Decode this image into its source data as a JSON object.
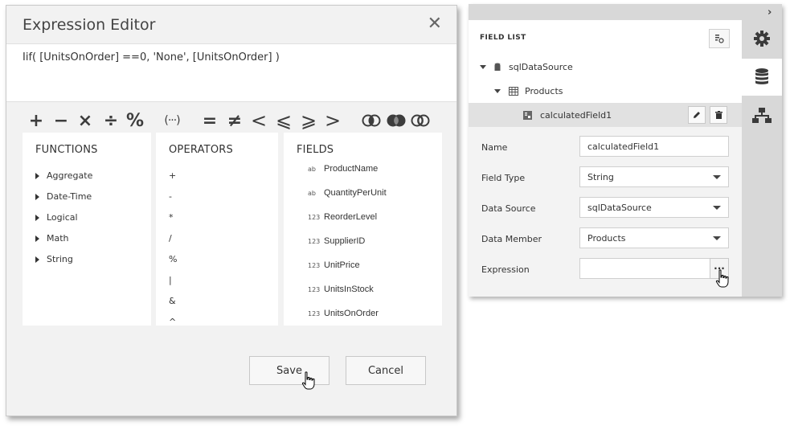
{
  "editor": {
    "title": "Expression Editor",
    "close_glyph": "✕",
    "expression": "Iif( [UnitsOnOrder] ==0, 'None', [UnitsOnOrder] )",
    "toolbar": [
      {
        "name": "plus-operator-button",
        "glyph": "+"
      },
      {
        "name": "minus-operator-button",
        "glyph": "−"
      },
      {
        "name": "multiply-operator-button",
        "glyph": "×"
      },
      {
        "name": "divide-operator-button",
        "glyph": "÷"
      },
      {
        "name": "modulo-operator-button",
        "glyph": "%"
      },
      {
        "name": "parentheses-button",
        "glyph": "(···)"
      },
      {
        "name": "equals-operator-button",
        "glyph": "="
      },
      {
        "name": "not-equal-operator-button",
        "glyph": "≠"
      },
      {
        "name": "less-than-operator-button",
        "glyph": "<"
      },
      {
        "name": "less-or-equal-operator-button",
        "glyph": "⩽"
      },
      {
        "name": "greater-or-equal-operator-button",
        "glyph": "⩾"
      },
      {
        "name": "greater-than-operator-button",
        "glyph": ">"
      },
      {
        "name": "and-operator-button",
        "glyph": "and"
      },
      {
        "name": "or-operator-button",
        "glyph": "or"
      },
      {
        "name": "not-operator-button",
        "glyph": "not"
      }
    ],
    "functions": {
      "header": "FUNCTIONS",
      "items": [
        "Aggregate",
        "Date-Time",
        "Logical",
        "Math",
        "String"
      ]
    },
    "operators": {
      "header": "OPERATORS",
      "items": [
        "+",
        "-",
        "*",
        "/",
        "%",
        "|",
        "&",
        "^"
      ]
    },
    "fields": {
      "header": "FIELDS",
      "items": [
        {
          "type": "ab",
          "label": "ProductName"
        },
        {
          "type": "ab",
          "label": "QuantityPerUnit"
        },
        {
          "type": "123",
          "label": "ReorderLevel"
        },
        {
          "type": "123",
          "label": "SupplierID"
        },
        {
          "type": "123",
          "label": "UnitPrice"
        },
        {
          "type": "123",
          "label": "UnitsInStock"
        },
        {
          "type": "123",
          "label": "UnitsOnOrder"
        }
      ]
    },
    "save_label": "Save",
    "cancel_label": "Cancel"
  },
  "field_list": {
    "title": "FIELD LIST",
    "tree": {
      "datasource": "sqlDataSource",
      "table": "Products",
      "selected_field": "calculatedField1"
    },
    "properties": {
      "name_label": "Name",
      "name_value": "calculatedField1",
      "field_type_label": "Field Type",
      "field_type_value": "String",
      "data_source_label": "Data Source",
      "data_source_value": "sqlDataSource",
      "data_member_label": "Data Member",
      "data_member_value": "Products",
      "expression_label": "Expression",
      "expression_value": "",
      "ellipsis": "···"
    },
    "rail_icons": [
      "gear-icon",
      "database-icon",
      "hierarchy-icon"
    ]
  }
}
